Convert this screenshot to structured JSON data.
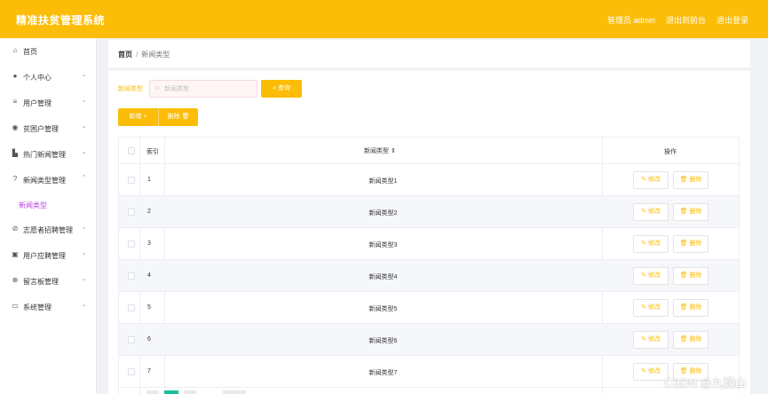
{
  "header": {
    "title": "精准扶贫管理系统",
    "admin_label": "管理员 admin",
    "frontend_link": "退出到前台",
    "logout_link": "退出登录"
  },
  "sidebar": {
    "items": [
      {
        "label": "首页",
        "icon": "home-icon"
      },
      {
        "label": "个人中心",
        "icon": "user-icon"
      },
      {
        "label": "用户管理",
        "icon": "list-icon"
      },
      {
        "label": "贫困户管理",
        "icon": "location-icon"
      },
      {
        "label": "热门新闻管理",
        "icon": "chart-icon"
      },
      {
        "label": "新闻类型管理",
        "icon": "help-icon"
      },
      {
        "label": "志愿者招聘管理",
        "icon": "compass-icon"
      },
      {
        "label": "用户应聘管理",
        "icon": "briefcase-icon"
      },
      {
        "label": "留言板管理",
        "icon": "globe-icon"
      },
      {
        "label": "系统管理",
        "icon": "message-icon"
      }
    ],
    "active_sub": "新闻类型"
  },
  "breadcrumb": {
    "home": "首页",
    "separator": "/",
    "current": "新闻类型"
  },
  "search": {
    "label": "新闻类型",
    "placeholder": "新闻类型",
    "value": "",
    "button": "查询"
  },
  "actions": {
    "add": "新增",
    "delete": "删除"
  },
  "table": {
    "headers": {
      "index": "索引",
      "name": "新闻类型",
      "ops": "操作"
    },
    "rows": [
      {
        "index": "1",
        "name": "新闻类型1"
      },
      {
        "index": "2",
        "name": "新闻类型2"
      },
      {
        "index": "3",
        "name": "新闻类型3"
      },
      {
        "index": "4",
        "name": "新闻类型4"
      },
      {
        "index": "5",
        "name": "新闻类型5"
      },
      {
        "index": "6",
        "name": "新闻类型6"
      },
      {
        "index": "7",
        "name": "新闻类型7"
      }
    ],
    "edit_label": "修改",
    "delete_label": "删除"
  },
  "watermark": "CSDN @九巍山",
  "colors": {
    "accent": "#fbbd08",
    "active_sub": "#b54ad8"
  }
}
